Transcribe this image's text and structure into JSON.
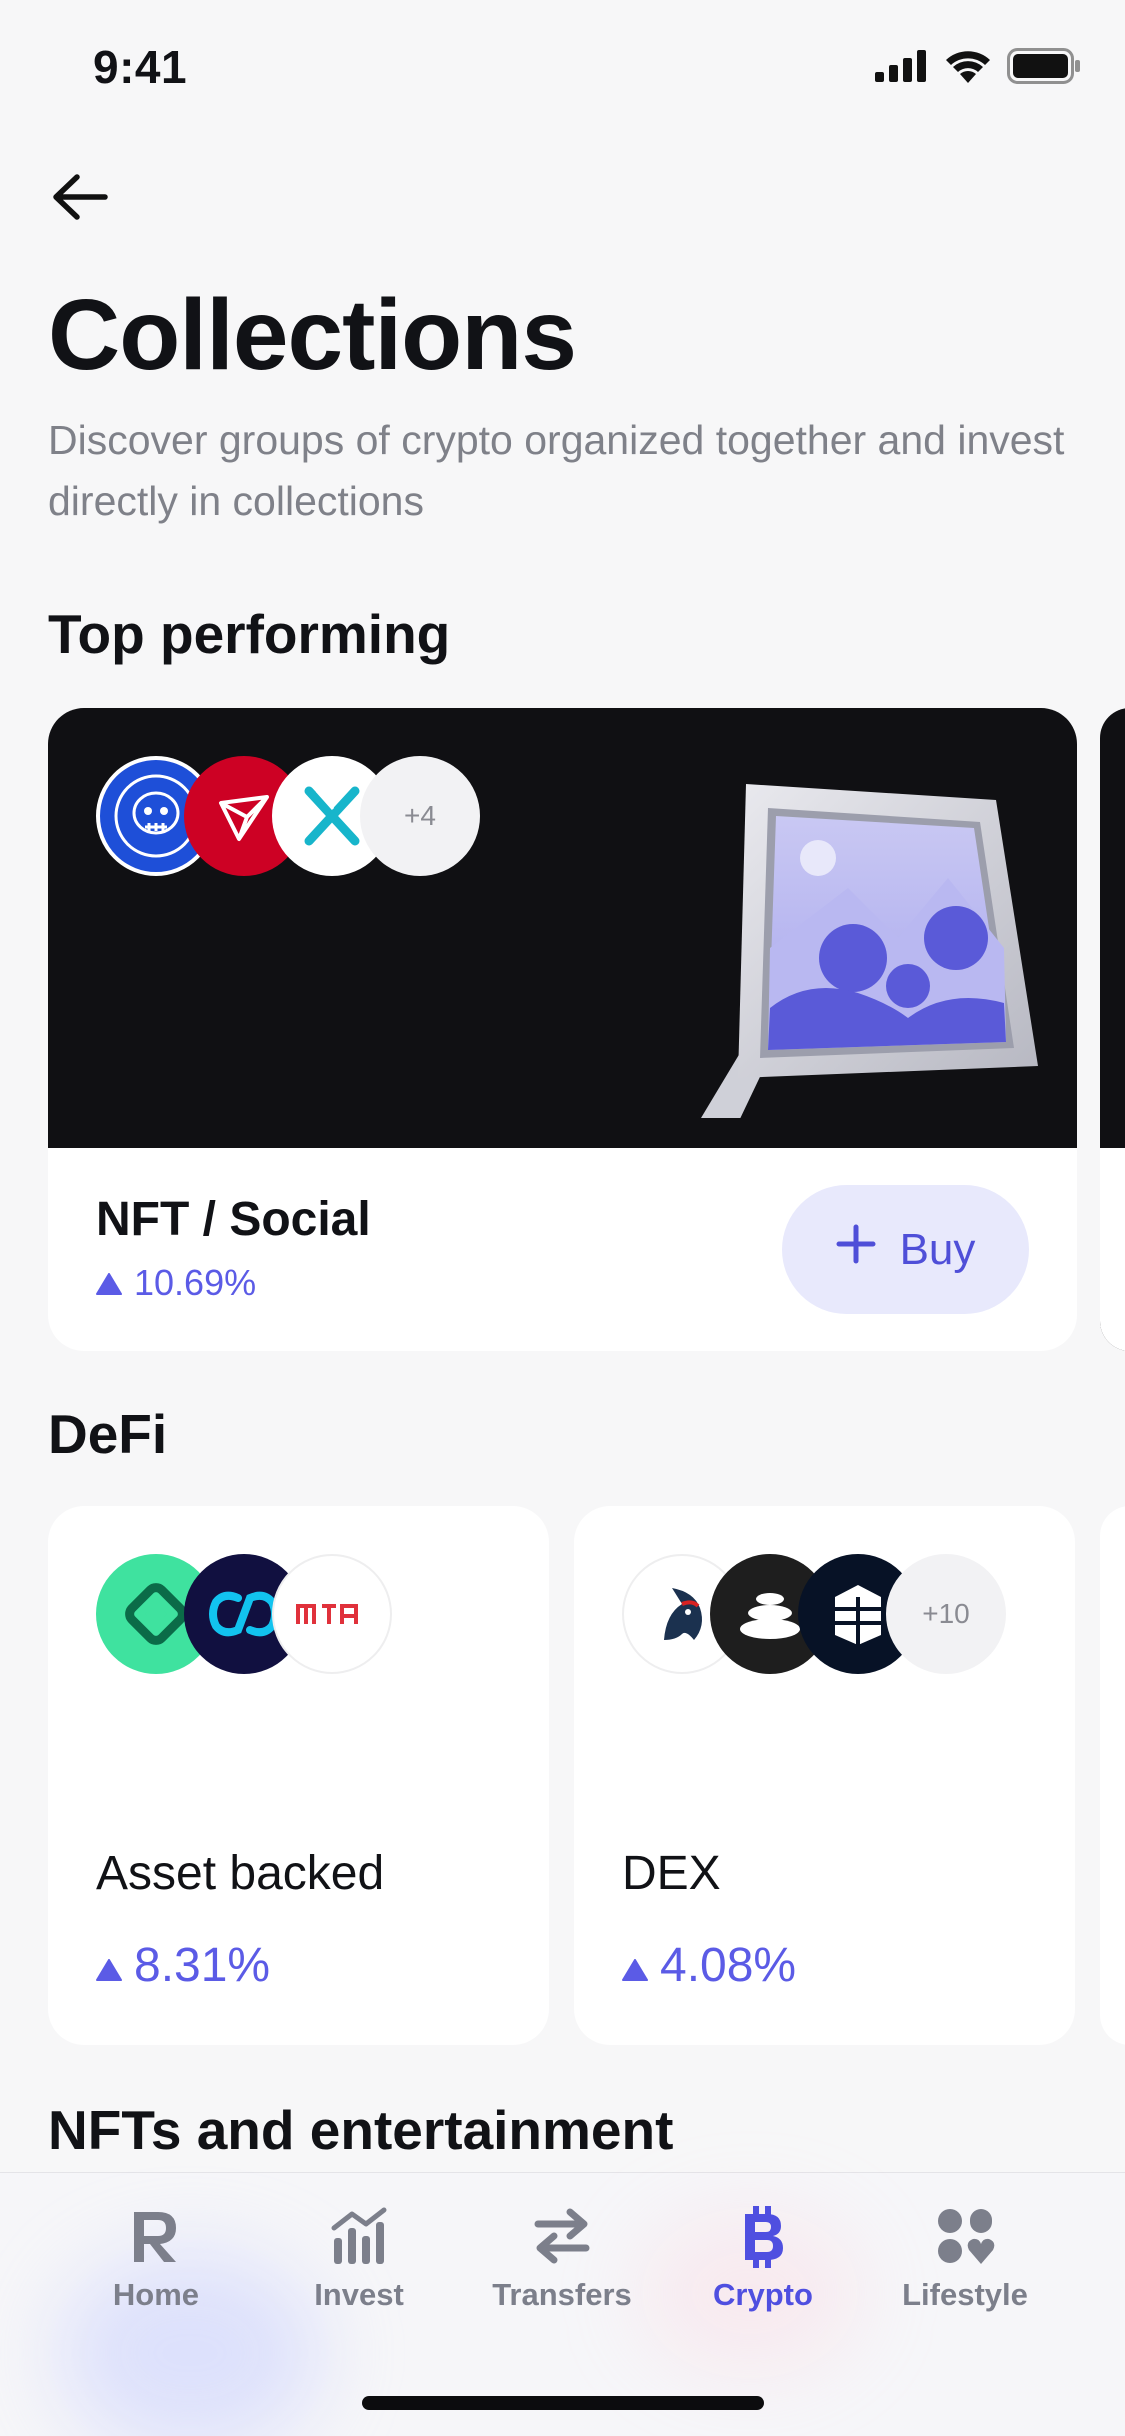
{
  "status_bar": {
    "time": "9:41"
  },
  "header": {
    "title": "Collections",
    "subtitle": "Discover groups of crypto organized together and invest directly in collections"
  },
  "sections": {
    "top_performing": "Top performing",
    "defi": "DeFi",
    "nfts_entertainment": "NFTs and entertainment"
  },
  "featured": {
    "name": "NFT / Social",
    "change": "10.69%",
    "buy_label": "Buy",
    "extra_count": "+4",
    "coins": [
      "apecoin-icon",
      "chiliz-icon",
      "immutable-x-icon"
    ]
  },
  "defi_cards": [
    {
      "name": "Asset backed",
      "change": "8.31%",
      "coins": [
        "pax-gold-icon",
        "synapse-icon",
        "mta-icon"
      ]
    },
    {
      "name": "DEX",
      "change": "4.08%",
      "extra_count": "+10",
      "coins": [
        "1inch-icon",
        "balancer-icon",
        "bancor-icon"
      ]
    }
  ],
  "tabs": [
    {
      "label": "Home",
      "icon": "revolut-r-icon",
      "active": false
    },
    {
      "label": "Invest",
      "icon": "bar-chart-icon",
      "active": false
    },
    {
      "label": "Transfers",
      "icon": "transfer-arrows-icon",
      "active": false
    },
    {
      "label": "Crypto",
      "icon": "bitcoin-icon",
      "active": true
    },
    {
      "label": "Lifestyle",
      "icon": "lifestyle-icon",
      "active": false
    }
  ],
  "colors": {
    "accent": "#4f4fe0",
    "background": "#f7f7f8",
    "card_dark": "#101013",
    "buy_button_bg": "#e8e9fc",
    "muted_text": "#7f8189"
  }
}
